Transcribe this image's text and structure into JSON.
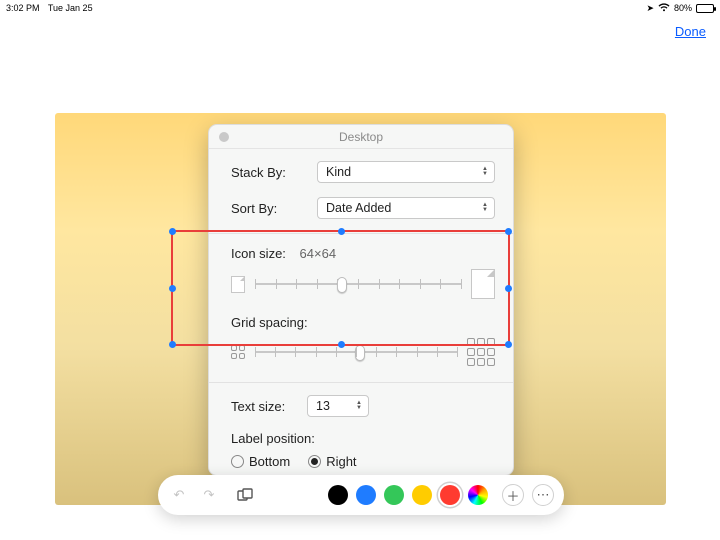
{
  "statusbar": {
    "time": "3:02 PM",
    "date": "Tue Jan 25",
    "battery_pct": "80%"
  },
  "nav": {
    "done": "Done"
  },
  "window": {
    "title": "Desktop",
    "stack_by_label": "Stack By:",
    "stack_by_value": "Kind",
    "sort_by_label": "Sort By:",
    "sort_by_value": "Date Added",
    "icon_size_label": "Icon size:",
    "icon_size_value": "64×64",
    "grid_spacing_label": "Grid spacing:",
    "text_size_label": "Text size:",
    "text_size_value": "13",
    "label_position_label": "Label position:",
    "label_bottom": "Bottom",
    "label_right": "Right",
    "label_selected": "right"
  },
  "colors": {
    "black": "#000000",
    "blue": "#1f7cff",
    "green": "#34c759",
    "yellow": "#ffcc00",
    "red": "#ff3b30"
  }
}
